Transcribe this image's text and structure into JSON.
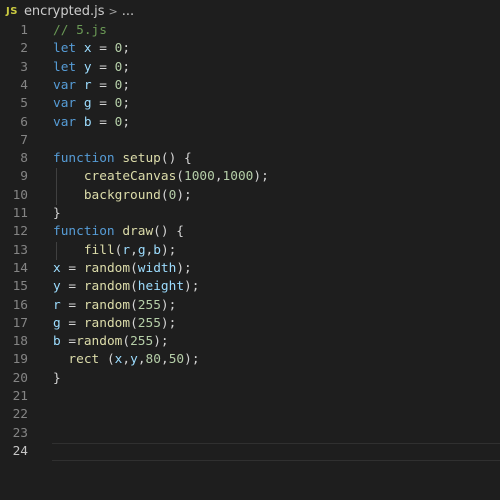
{
  "breadcrumb": {
    "icon_text": "JS",
    "filename": "encrypted.js",
    "separator": ">",
    "more": "..."
  },
  "editor": {
    "active_line": 24,
    "lines": [
      {
        "number": "1",
        "tokens": [
          {
            "t": "// 5.js",
            "c": "comment"
          }
        ]
      },
      {
        "number": "2",
        "tokens": [
          {
            "t": "let ",
            "c": "kw"
          },
          {
            "t": "x",
            "c": "var"
          },
          {
            "t": " = ",
            "c": "op"
          },
          {
            "t": "0",
            "c": "num"
          },
          {
            "t": ";",
            "c": "plain"
          }
        ]
      },
      {
        "number": "3",
        "tokens": [
          {
            "t": "let ",
            "c": "kw"
          },
          {
            "t": "y",
            "c": "var"
          },
          {
            "t": " = ",
            "c": "op"
          },
          {
            "t": "0",
            "c": "num"
          },
          {
            "t": ";",
            "c": "plain"
          }
        ]
      },
      {
        "number": "4",
        "tokens": [
          {
            "t": "var ",
            "c": "kw"
          },
          {
            "t": "r",
            "c": "var"
          },
          {
            "t": " = ",
            "c": "op"
          },
          {
            "t": "0",
            "c": "num"
          },
          {
            "t": ";",
            "c": "plain"
          }
        ]
      },
      {
        "number": "5",
        "tokens": [
          {
            "t": "var ",
            "c": "kw"
          },
          {
            "t": "g",
            "c": "var"
          },
          {
            "t": " = ",
            "c": "op"
          },
          {
            "t": "0",
            "c": "num"
          },
          {
            "t": ";",
            "c": "plain"
          }
        ]
      },
      {
        "number": "6",
        "tokens": [
          {
            "t": "var ",
            "c": "kw"
          },
          {
            "t": "b",
            "c": "var"
          },
          {
            "t": " = ",
            "c": "op"
          },
          {
            "t": "0",
            "c": "num"
          },
          {
            "t": ";",
            "c": "plain"
          }
        ]
      },
      {
        "number": "7",
        "tokens": []
      },
      {
        "number": "8",
        "tokens": [
          {
            "t": "function ",
            "c": "kw"
          },
          {
            "t": "setup",
            "c": "fn"
          },
          {
            "t": "() {",
            "c": "plain"
          }
        ]
      },
      {
        "number": "9",
        "guide": true,
        "tokens": [
          {
            "t": "    ",
            "c": "plain"
          },
          {
            "t": "createCanvas",
            "c": "fn"
          },
          {
            "t": "(",
            "c": "plain"
          },
          {
            "t": "1000",
            "c": "num"
          },
          {
            "t": ",",
            "c": "plain"
          },
          {
            "t": "1000",
            "c": "num"
          },
          {
            "t": ");",
            "c": "plain"
          }
        ]
      },
      {
        "number": "10",
        "guide": true,
        "tokens": [
          {
            "t": "    ",
            "c": "plain"
          },
          {
            "t": "background",
            "c": "fn"
          },
          {
            "t": "(",
            "c": "plain"
          },
          {
            "t": "0",
            "c": "num"
          },
          {
            "t": ");",
            "c": "plain"
          }
        ]
      },
      {
        "number": "11",
        "tokens": [
          {
            "t": "}",
            "c": "plain"
          }
        ]
      },
      {
        "number": "12",
        "tokens": [
          {
            "t": "function ",
            "c": "kw"
          },
          {
            "t": "draw",
            "c": "fn"
          },
          {
            "t": "() {",
            "c": "plain"
          }
        ]
      },
      {
        "number": "13",
        "guide": true,
        "tokens": [
          {
            "t": "    ",
            "c": "plain"
          },
          {
            "t": "fill",
            "c": "fn"
          },
          {
            "t": "(",
            "c": "plain"
          },
          {
            "t": "r",
            "c": "var"
          },
          {
            "t": ",",
            "c": "plain"
          },
          {
            "t": "g",
            "c": "var"
          },
          {
            "t": ",",
            "c": "plain"
          },
          {
            "t": "b",
            "c": "var"
          },
          {
            "t": ");",
            "c": "plain"
          }
        ]
      },
      {
        "number": "14",
        "tokens": [
          {
            "t": "x",
            "c": "var"
          },
          {
            "t": " = ",
            "c": "op"
          },
          {
            "t": "random",
            "c": "fn"
          },
          {
            "t": "(",
            "c": "plain"
          },
          {
            "t": "width",
            "c": "var"
          },
          {
            "t": ");",
            "c": "plain"
          }
        ]
      },
      {
        "number": "15",
        "tokens": [
          {
            "t": "y",
            "c": "var"
          },
          {
            "t": " = ",
            "c": "op"
          },
          {
            "t": "random",
            "c": "fn"
          },
          {
            "t": "(",
            "c": "plain"
          },
          {
            "t": "height",
            "c": "var"
          },
          {
            "t": ");",
            "c": "plain"
          }
        ]
      },
      {
        "number": "16",
        "tokens": [
          {
            "t": "r",
            "c": "var"
          },
          {
            "t": " = ",
            "c": "op"
          },
          {
            "t": "random",
            "c": "fn"
          },
          {
            "t": "(",
            "c": "plain"
          },
          {
            "t": "255",
            "c": "num"
          },
          {
            "t": ");",
            "c": "plain"
          }
        ]
      },
      {
        "number": "17",
        "tokens": [
          {
            "t": "g",
            "c": "var"
          },
          {
            "t": " = ",
            "c": "op"
          },
          {
            "t": "random",
            "c": "fn"
          },
          {
            "t": "(",
            "c": "plain"
          },
          {
            "t": "255",
            "c": "num"
          },
          {
            "t": ");",
            "c": "plain"
          }
        ]
      },
      {
        "number": "18",
        "tokens": [
          {
            "t": "b",
            "c": "var"
          },
          {
            "t": " =",
            "c": "op"
          },
          {
            "t": "random",
            "c": "fn"
          },
          {
            "t": "(",
            "c": "plain"
          },
          {
            "t": "255",
            "c": "num"
          },
          {
            "t": ");",
            "c": "plain"
          }
        ]
      },
      {
        "number": "19",
        "tokens": [
          {
            "t": "  ",
            "c": "plain"
          },
          {
            "t": "rect",
            "c": "fn"
          },
          {
            "t": " (",
            "c": "plain"
          },
          {
            "t": "x",
            "c": "var"
          },
          {
            "t": ",",
            "c": "plain"
          },
          {
            "t": "y",
            "c": "var"
          },
          {
            "t": ",",
            "c": "plain"
          },
          {
            "t": "80",
            "c": "num"
          },
          {
            "t": ",",
            "c": "plain"
          },
          {
            "t": "50",
            "c": "num"
          },
          {
            "t": ");",
            "c": "plain"
          }
        ]
      },
      {
        "number": "20",
        "tokens": [
          {
            "t": "}",
            "c": "plain"
          }
        ]
      },
      {
        "number": "21",
        "tokens": []
      },
      {
        "number": "22",
        "tokens": []
      },
      {
        "number": "23",
        "tokens": []
      },
      {
        "number": "24",
        "tokens": []
      }
    ]
  }
}
